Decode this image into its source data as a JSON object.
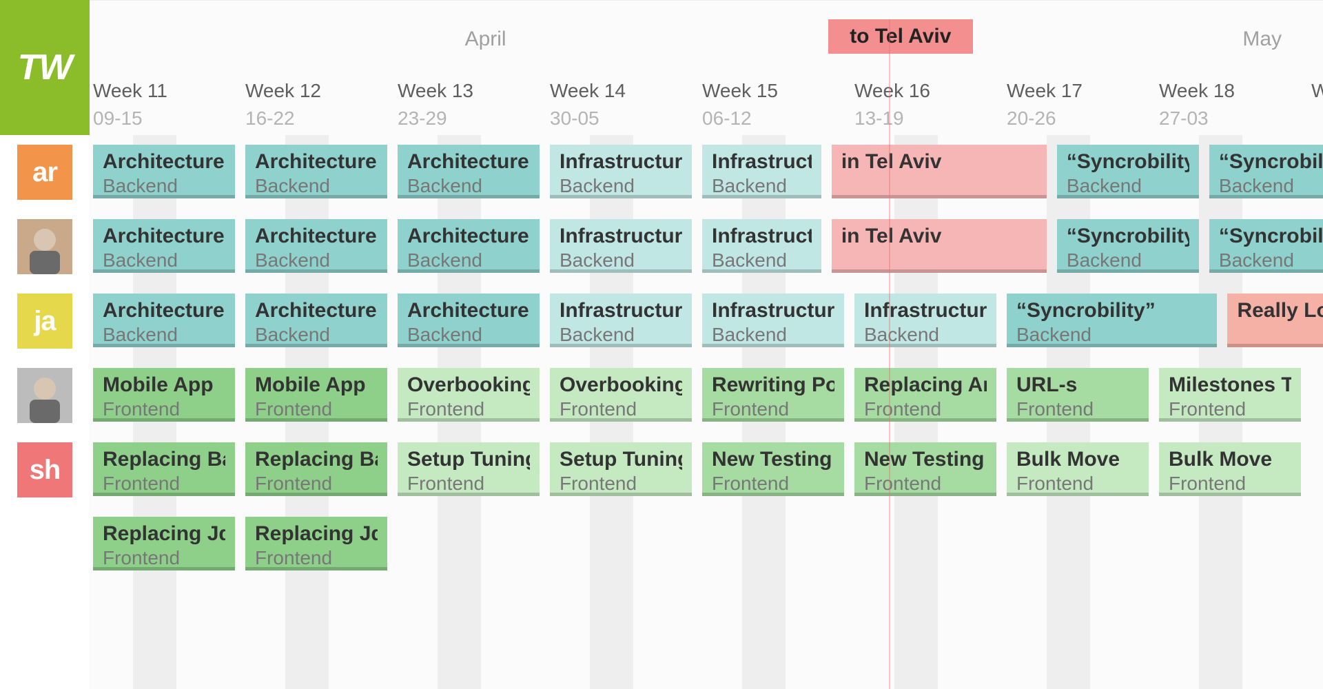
{
  "logo_text": "TW",
  "months": [
    {
      "label": "April",
      "center_col": 2.6
    },
    {
      "label": "May",
      "center_col": 7.7
    }
  ],
  "header_event": {
    "label": "to Tel Aviv",
    "bg": "#f38f8f",
    "left_col": 4.85,
    "width_cols": 0.95
  },
  "now_marker_col": 5.25,
  "weeks": [
    {
      "label": "Week 11",
      "range": "09-15"
    },
    {
      "label": "Week 12",
      "range": "16-22"
    },
    {
      "label": "Week 13",
      "range": "23-29"
    },
    {
      "label": "Week 14",
      "range": "30-05"
    },
    {
      "label": "Week 15",
      "range": "06-12"
    },
    {
      "label": "Week 16",
      "range": "13-19"
    },
    {
      "label": "Week 17",
      "range": "20-26"
    },
    {
      "label": "Week 18",
      "range": "27-03"
    },
    {
      "label": "W",
      "range": ""
    }
  ],
  "people": [
    {
      "id": "ar",
      "display": "ar",
      "bg": "#f2954a",
      "photo": false
    },
    {
      "id": "p2",
      "display": "",
      "bg": "#c9a98a",
      "photo": true
    },
    {
      "id": "ja",
      "display": "ja",
      "bg": "#e6d84b",
      "photo": false
    },
    {
      "id": "p4",
      "display": "",
      "bg": "#bcbcbc",
      "photo": true
    },
    {
      "id": "sh",
      "display": "sh",
      "bg": "#f07777",
      "photo": false
    }
  ],
  "palette": {
    "teal": "#8fd1cc",
    "teal_light": "#c1e7e5",
    "pink": "#f6b6b5",
    "coral": "#f6b1a6",
    "green": "#8ed08a",
    "green_mid": "#a6dba1",
    "green_light": "#c5eac2"
  },
  "subtitles": {
    "backend": "Backend",
    "frontend": "Frontend"
  },
  "rows": [
    {
      "person": "ar",
      "track": 0,
      "cards": [
        {
          "title": "Architecture",
          "subtitle": "backend",
          "bg": "teal",
          "start": 0,
          "span": 0.95
        },
        {
          "title": "Architecture",
          "subtitle": "backend",
          "bg": "teal",
          "start": 1,
          "span": 0.95
        },
        {
          "title": "Architecture",
          "subtitle": "backend",
          "bg": "teal",
          "start": 2,
          "span": 0.95
        },
        {
          "title": "Infrastructure",
          "subtitle": "backend",
          "bg": "teal_light",
          "start": 3,
          "span": 0.95
        },
        {
          "title": "Infrastructure",
          "subtitle": "backend",
          "bg": "teal_light",
          "start": 4,
          "span": 0.8
        },
        {
          "title": "in Tel Aviv",
          "subtitle": "",
          "bg": "pink",
          "start": 4.85,
          "span": 1.43
        },
        {
          "title": "“Syncrobility”",
          "subtitle": "backend",
          "bg": "teal",
          "start": 6.33,
          "span": 0.95
        },
        {
          "title": "“Syncrobility”",
          "subtitle": "backend",
          "bg": "teal",
          "start": 7.33,
          "span": 0.95
        }
      ]
    },
    {
      "person": "p2",
      "track": 0,
      "cards": [
        {
          "title": "Architecture",
          "subtitle": "backend",
          "bg": "teal",
          "start": 0,
          "span": 0.95
        },
        {
          "title": "Architecture",
          "subtitle": "backend",
          "bg": "teal",
          "start": 1,
          "span": 0.95
        },
        {
          "title": "Architecture",
          "subtitle": "backend",
          "bg": "teal",
          "start": 2,
          "span": 0.95
        },
        {
          "title": "Infrastructure",
          "subtitle": "backend",
          "bg": "teal_light",
          "start": 3,
          "span": 0.95
        },
        {
          "title": "Infrastructure",
          "subtitle": "backend",
          "bg": "teal_light",
          "start": 4,
          "span": 0.8
        },
        {
          "title": "in Tel Aviv",
          "subtitle": "",
          "bg": "pink",
          "start": 4.85,
          "span": 1.43
        },
        {
          "title": "“Syncrobility”",
          "subtitle": "backend",
          "bg": "teal",
          "start": 6.33,
          "span": 0.95
        },
        {
          "title": "“Syncrobility”",
          "subtitle": "backend",
          "bg": "teal",
          "start": 7.33,
          "span": 0.95
        }
      ]
    },
    {
      "person": "ja",
      "track": 0,
      "cards": [
        {
          "title": "Architecture",
          "subtitle": "backend",
          "bg": "teal",
          "start": 0,
          "span": 0.95
        },
        {
          "title": "Architecture",
          "subtitle": "backend",
          "bg": "teal",
          "start": 1,
          "span": 0.95
        },
        {
          "title": "Architecture",
          "subtitle": "backend",
          "bg": "teal",
          "start": 2,
          "span": 0.95
        },
        {
          "title": "Infrastructure",
          "subtitle": "backend",
          "bg": "teal_light",
          "start": 3,
          "span": 0.95
        },
        {
          "title": "Infrastructure",
          "subtitle": "backend",
          "bg": "teal_light",
          "start": 4,
          "span": 0.95
        },
        {
          "title": "Infrastructure",
          "subtitle": "backend",
          "bg": "teal_light",
          "start": 5,
          "span": 0.95
        },
        {
          "title": "“Syncrobility”",
          "subtitle": "backend",
          "bg": "teal",
          "start": 6,
          "span": 1.4
        },
        {
          "title": "Really Long",
          "subtitle": "",
          "bg": "coral",
          "start": 7.45,
          "span": 1.0
        }
      ]
    },
    {
      "person": "p4",
      "track": 0,
      "cards": [
        {
          "title": "Mobile App",
          "subtitle": "frontend",
          "bg": "green",
          "start": 0,
          "span": 0.95
        },
        {
          "title": "Mobile App",
          "subtitle": "frontend",
          "bg": "green",
          "start": 1,
          "span": 0.95
        },
        {
          "title": "Overbooking",
          "subtitle": "frontend",
          "bg": "green_light",
          "start": 2,
          "span": 0.95
        },
        {
          "title": "Overbooking",
          "subtitle": "frontend",
          "bg": "green_light",
          "start": 3,
          "span": 0.95
        },
        {
          "title": "Rewriting Po",
          "subtitle": "frontend",
          "bg": "green_mid",
          "start": 4,
          "span": 0.95
        },
        {
          "title": "Replacing An",
          "subtitle": "frontend",
          "bg": "green_mid",
          "start": 5,
          "span": 0.95
        },
        {
          "title": "URL-s",
          "subtitle": "frontend",
          "bg": "green_mid",
          "start": 6,
          "span": 0.95
        },
        {
          "title": "Milestones T",
          "subtitle": "frontend",
          "bg": "green_light",
          "start": 7,
          "span": 0.95
        }
      ]
    },
    {
      "person": "sh",
      "track": 0,
      "cards": [
        {
          "title": "Replacing Ba",
          "subtitle": "frontend",
          "bg": "green",
          "start": 0,
          "span": 0.95
        },
        {
          "title": "Replacing Ba",
          "subtitle": "frontend",
          "bg": "green",
          "start": 1,
          "span": 0.95
        },
        {
          "title": "Setup Tuning",
          "subtitle": "frontend",
          "bg": "green_light",
          "start": 2,
          "span": 0.95
        },
        {
          "title": "Setup Tuning",
          "subtitle": "frontend",
          "bg": "green_light",
          "start": 3,
          "span": 0.95
        },
        {
          "title": "New Testing",
          "subtitle": "frontend",
          "bg": "green_mid",
          "start": 4,
          "span": 0.95
        },
        {
          "title": "New Testing",
          "subtitle": "frontend",
          "bg": "green_mid",
          "start": 5,
          "span": 0.95
        },
        {
          "title": "Bulk Move",
          "subtitle": "frontend",
          "bg": "green_light",
          "start": 6,
          "span": 0.95
        },
        {
          "title": "Bulk Move",
          "subtitle": "frontend",
          "bg": "green_light",
          "start": 7,
          "span": 0.95
        }
      ]
    },
    {
      "person": "sh",
      "track": 1,
      "cards": [
        {
          "title": "Replacing Jq",
          "subtitle": "frontend",
          "bg": "green",
          "start": 0,
          "span": 0.95
        },
        {
          "title": "Replacing Jq",
          "subtitle": "frontend",
          "bg": "green",
          "start": 1,
          "span": 0.95
        }
      ]
    }
  ]
}
